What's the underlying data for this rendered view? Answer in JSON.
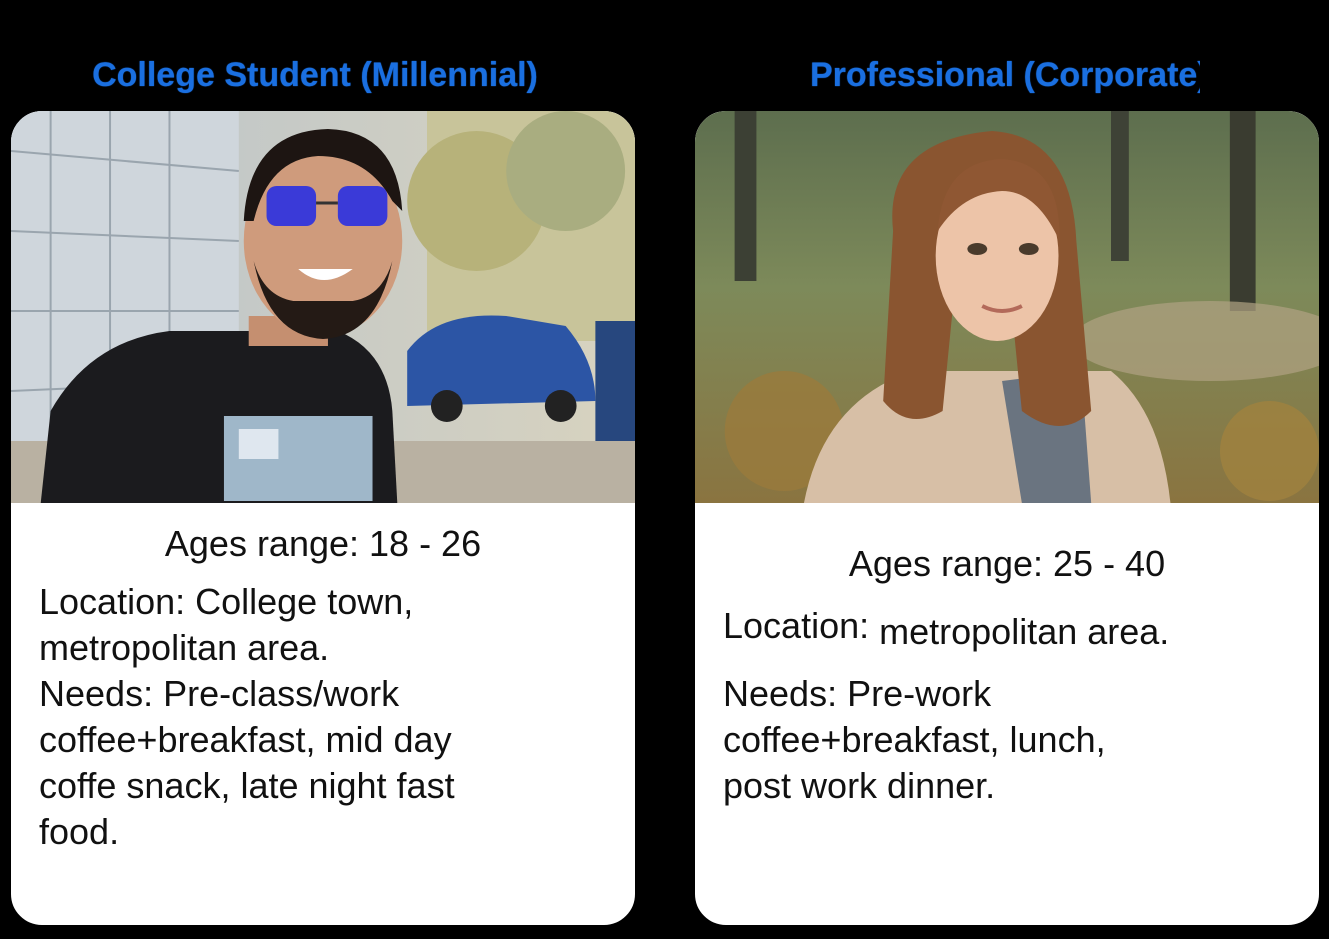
{
  "personas": [
    {
      "title": "College Student (Millennial)",
      "ages": "Ages range: 18 - 26",
      "location": [
        "Location: College town,",
        "metropolitan area."
      ],
      "needs": [
        "Needs: Pre-class/work",
        "coffee+breakfast, mid day",
        "coffe snack, late night fast",
        "food."
      ]
    },
    {
      "title": "Professional (Corporate)",
      "ages": "Ages range: 25 - 40",
      "location_label": "Location:",
      "location_value": "metropolitan area.",
      "needs": [
        "Needs: Pre-work",
        "coffee+breakfast, lunch,",
        "post work dinner."
      ]
    }
  ],
  "colors": {
    "title": "#1a6fe0",
    "background": "#000000",
    "card": "#ffffff"
  }
}
